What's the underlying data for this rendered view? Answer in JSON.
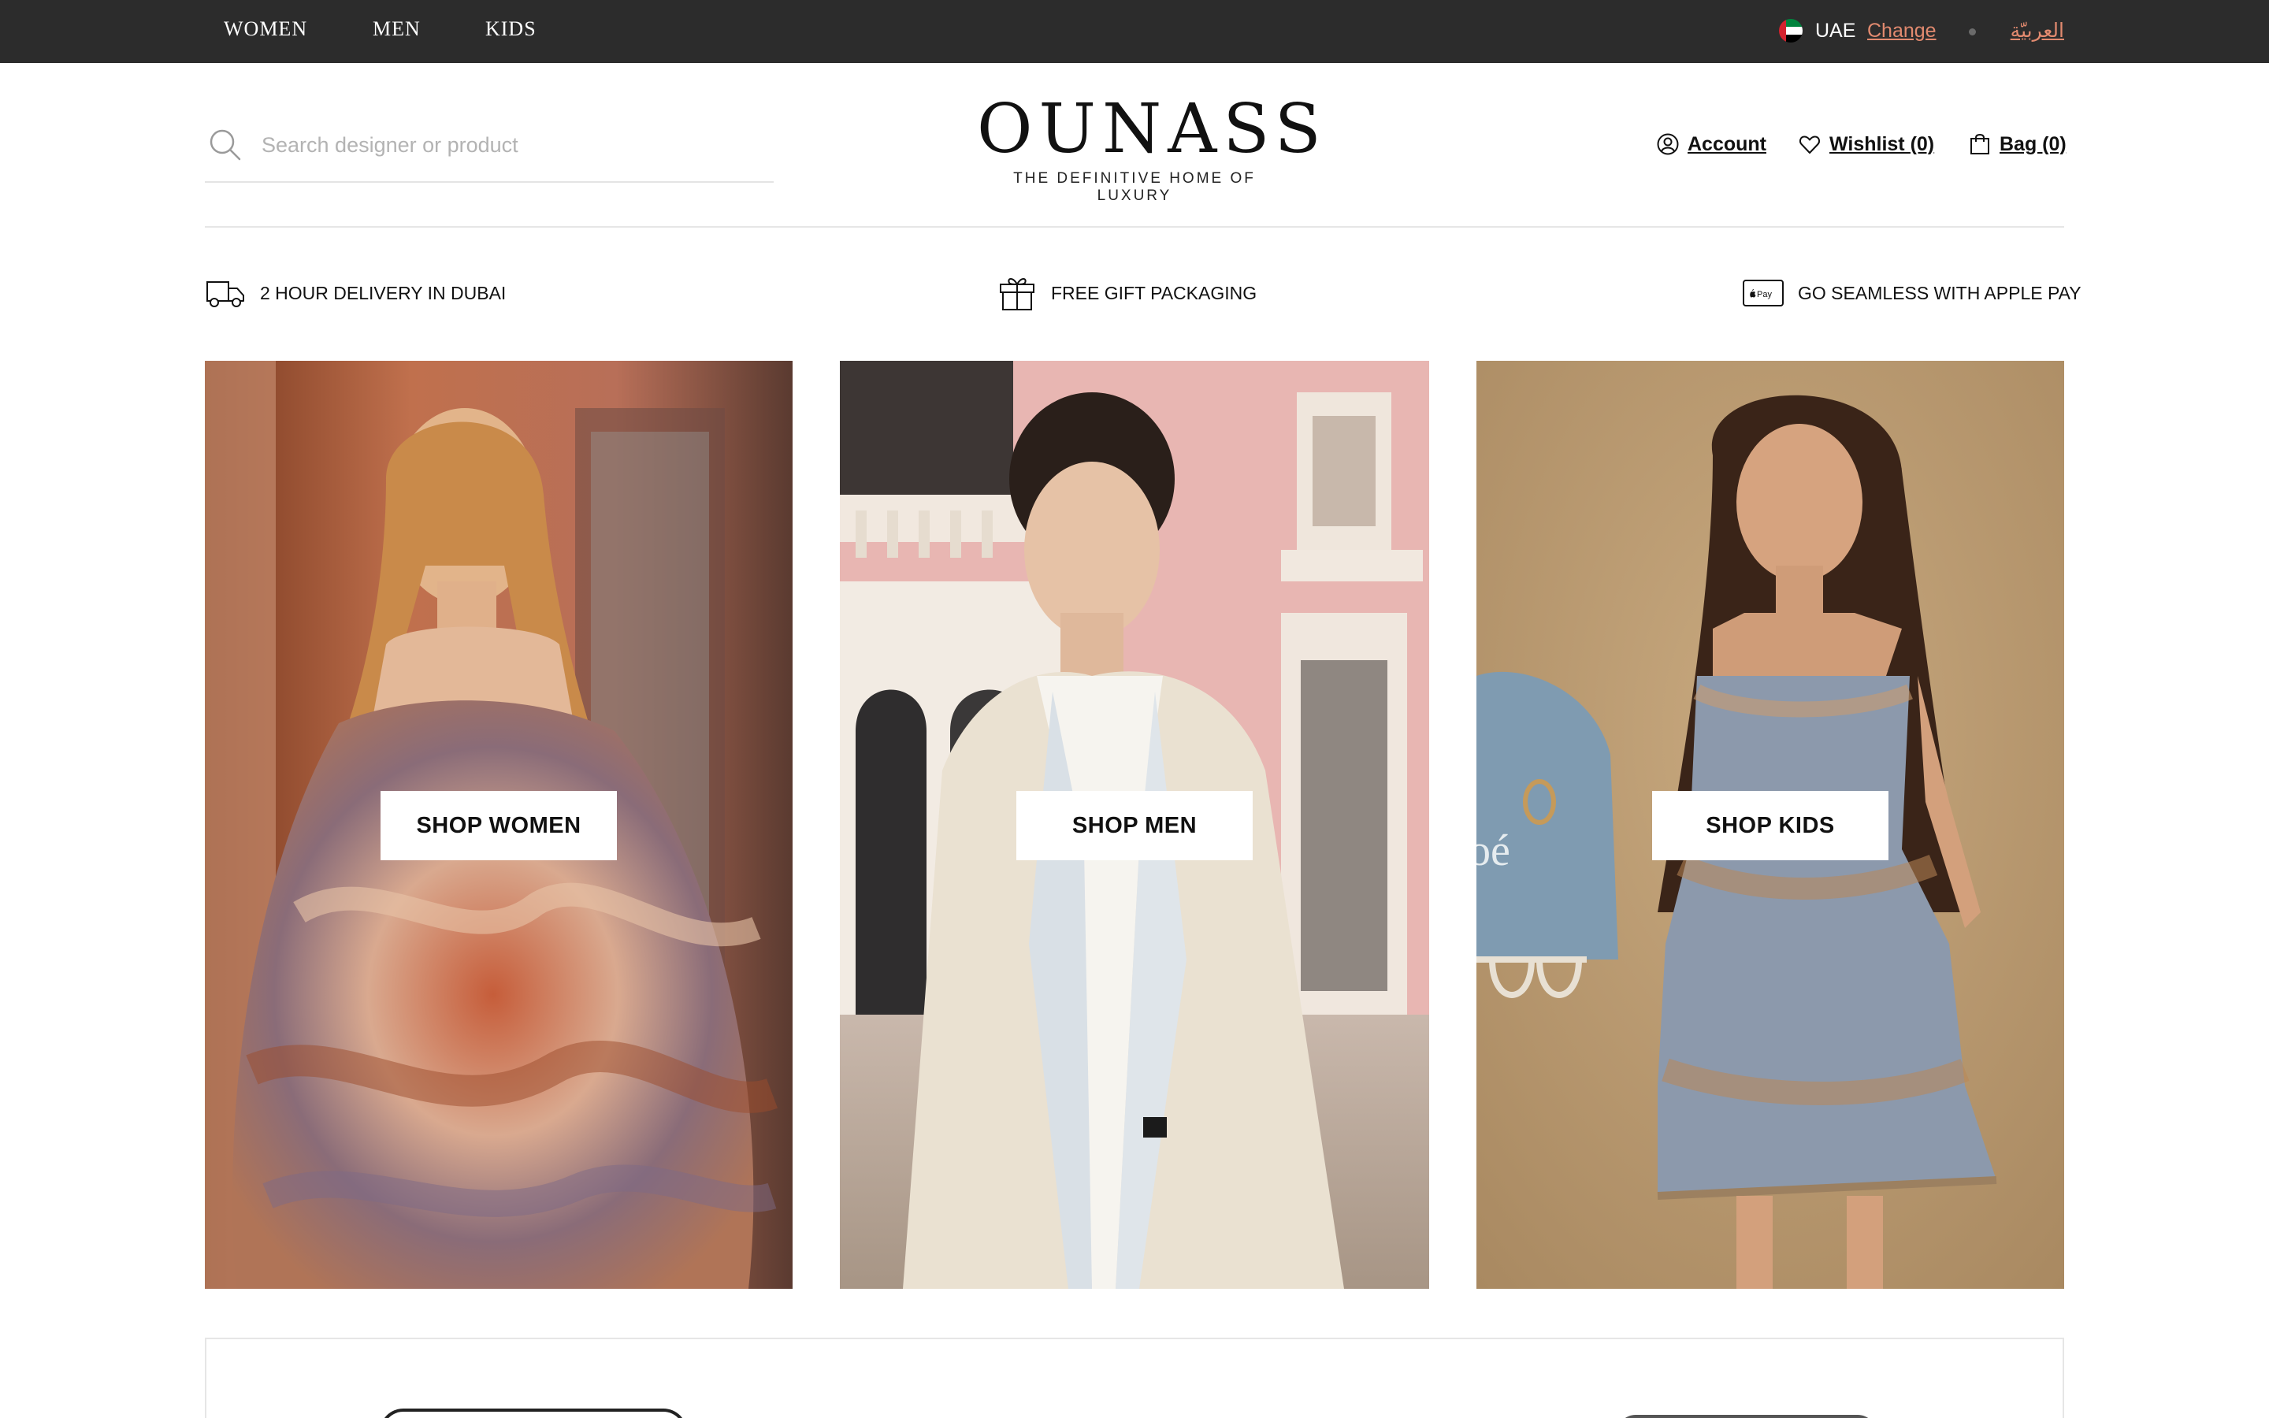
{
  "topbar": {
    "nav": [
      "WOMEN",
      "MEN",
      "KIDS"
    ],
    "country": "UAE",
    "change_label": "Change",
    "language_label": "العربيّة"
  },
  "header": {
    "search_placeholder": "Search designer or product",
    "logo_text": "OUNASS",
    "tagline": "THE DEFINITIVE HOME OF LUXURY",
    "account_label": "Account",
    "wishlist_label": "Wishlist (0)",
    "bag_label": "Bag (0)"
  },
  "usps": {
    "delivery": "2 HOUR DELIVERY IN DUBAI",
    "gift": "FREE GIFT PACKAGING",
    "applepay": "GO SEAMLESS WITH APPLE PAY",
    "applepay_badge": "Pay"
  },
  "tiles": {
    "women": "SHOP WOMEN",
    "men": "SHOP MEN",
    "kids": "SHOP KIDS",
    "kids_bag_text": "oé"
  },
  "colors": {
    "topbar_bg": "#2c2c2c",
    "accent_link": "#e28a6f",
    "divider": "#e6e6e6"
  },
  "icons": {
    "search": "search-icon",
    "account": "user-circle-icon",
    "wishlist": "heart-icon",
    "bag": "shopping-bag-icon",
    "delivery": "delivery-van-icon",
    "gift": "gift-box-icon",
    "applepay": "apple-pay-icon"
  }
}
